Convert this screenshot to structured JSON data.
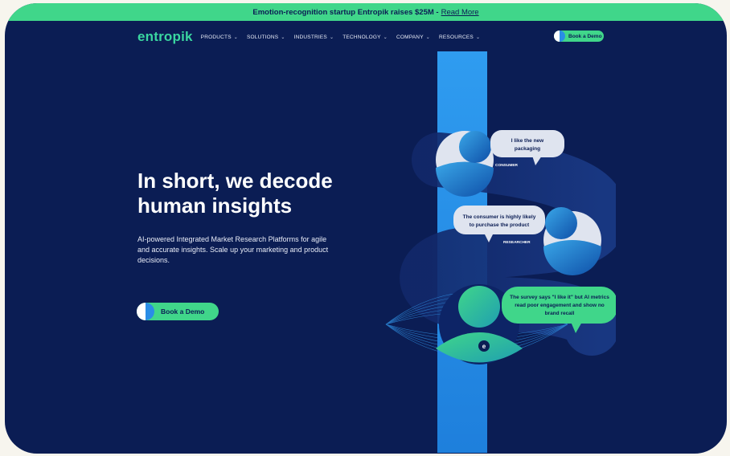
{
  "announcement": {
    "text": "Emotion-recognition startup Entropik raises $25M -",
    "link": "Read More"
  },
  "nav": {
    "logo": "entropik",
    "items": [
      "PRODUCTS",
      "SOLUTIONS",
      "INDUSTRIES",
      "TECHNOLOGY",
      "COMPANY",
      "RESOURCES"
    ],
    "cta": "Book a Demo"
  },
  "hero": {
    "title_line1": "In short, we decode",
    "title_line2": "human insights",
    "subtitle": "AI-powered Integrated Market Research Platforms for agile and accurate insights. Scale up your marketing and product decisions.",
    "cta": "Book a Demo"
  },
  "illustration": {
    "bubble1_line1": "I like the new",
    "bubble1_line2": "packaging",
    "tag1": "CONSUMER",
    "bubble2_line1": "The consumer is highly likely",
    "bubble2_line2": "to purchase the product",
    "tag2": "RESEARCHER",
    "bubble3_line1": "The survey says \"I like it\" but AI metrics",
    "bubble3_line2": "read poor engagement and show no",
    "bubble3_line3": "brand recall",
    "badge": "e"
  },
  "colors": {
    "background": "#0b1d54",
    "accent_green": "#40d68a",
    "accent_blue": "#2a8de6"
  }
}
